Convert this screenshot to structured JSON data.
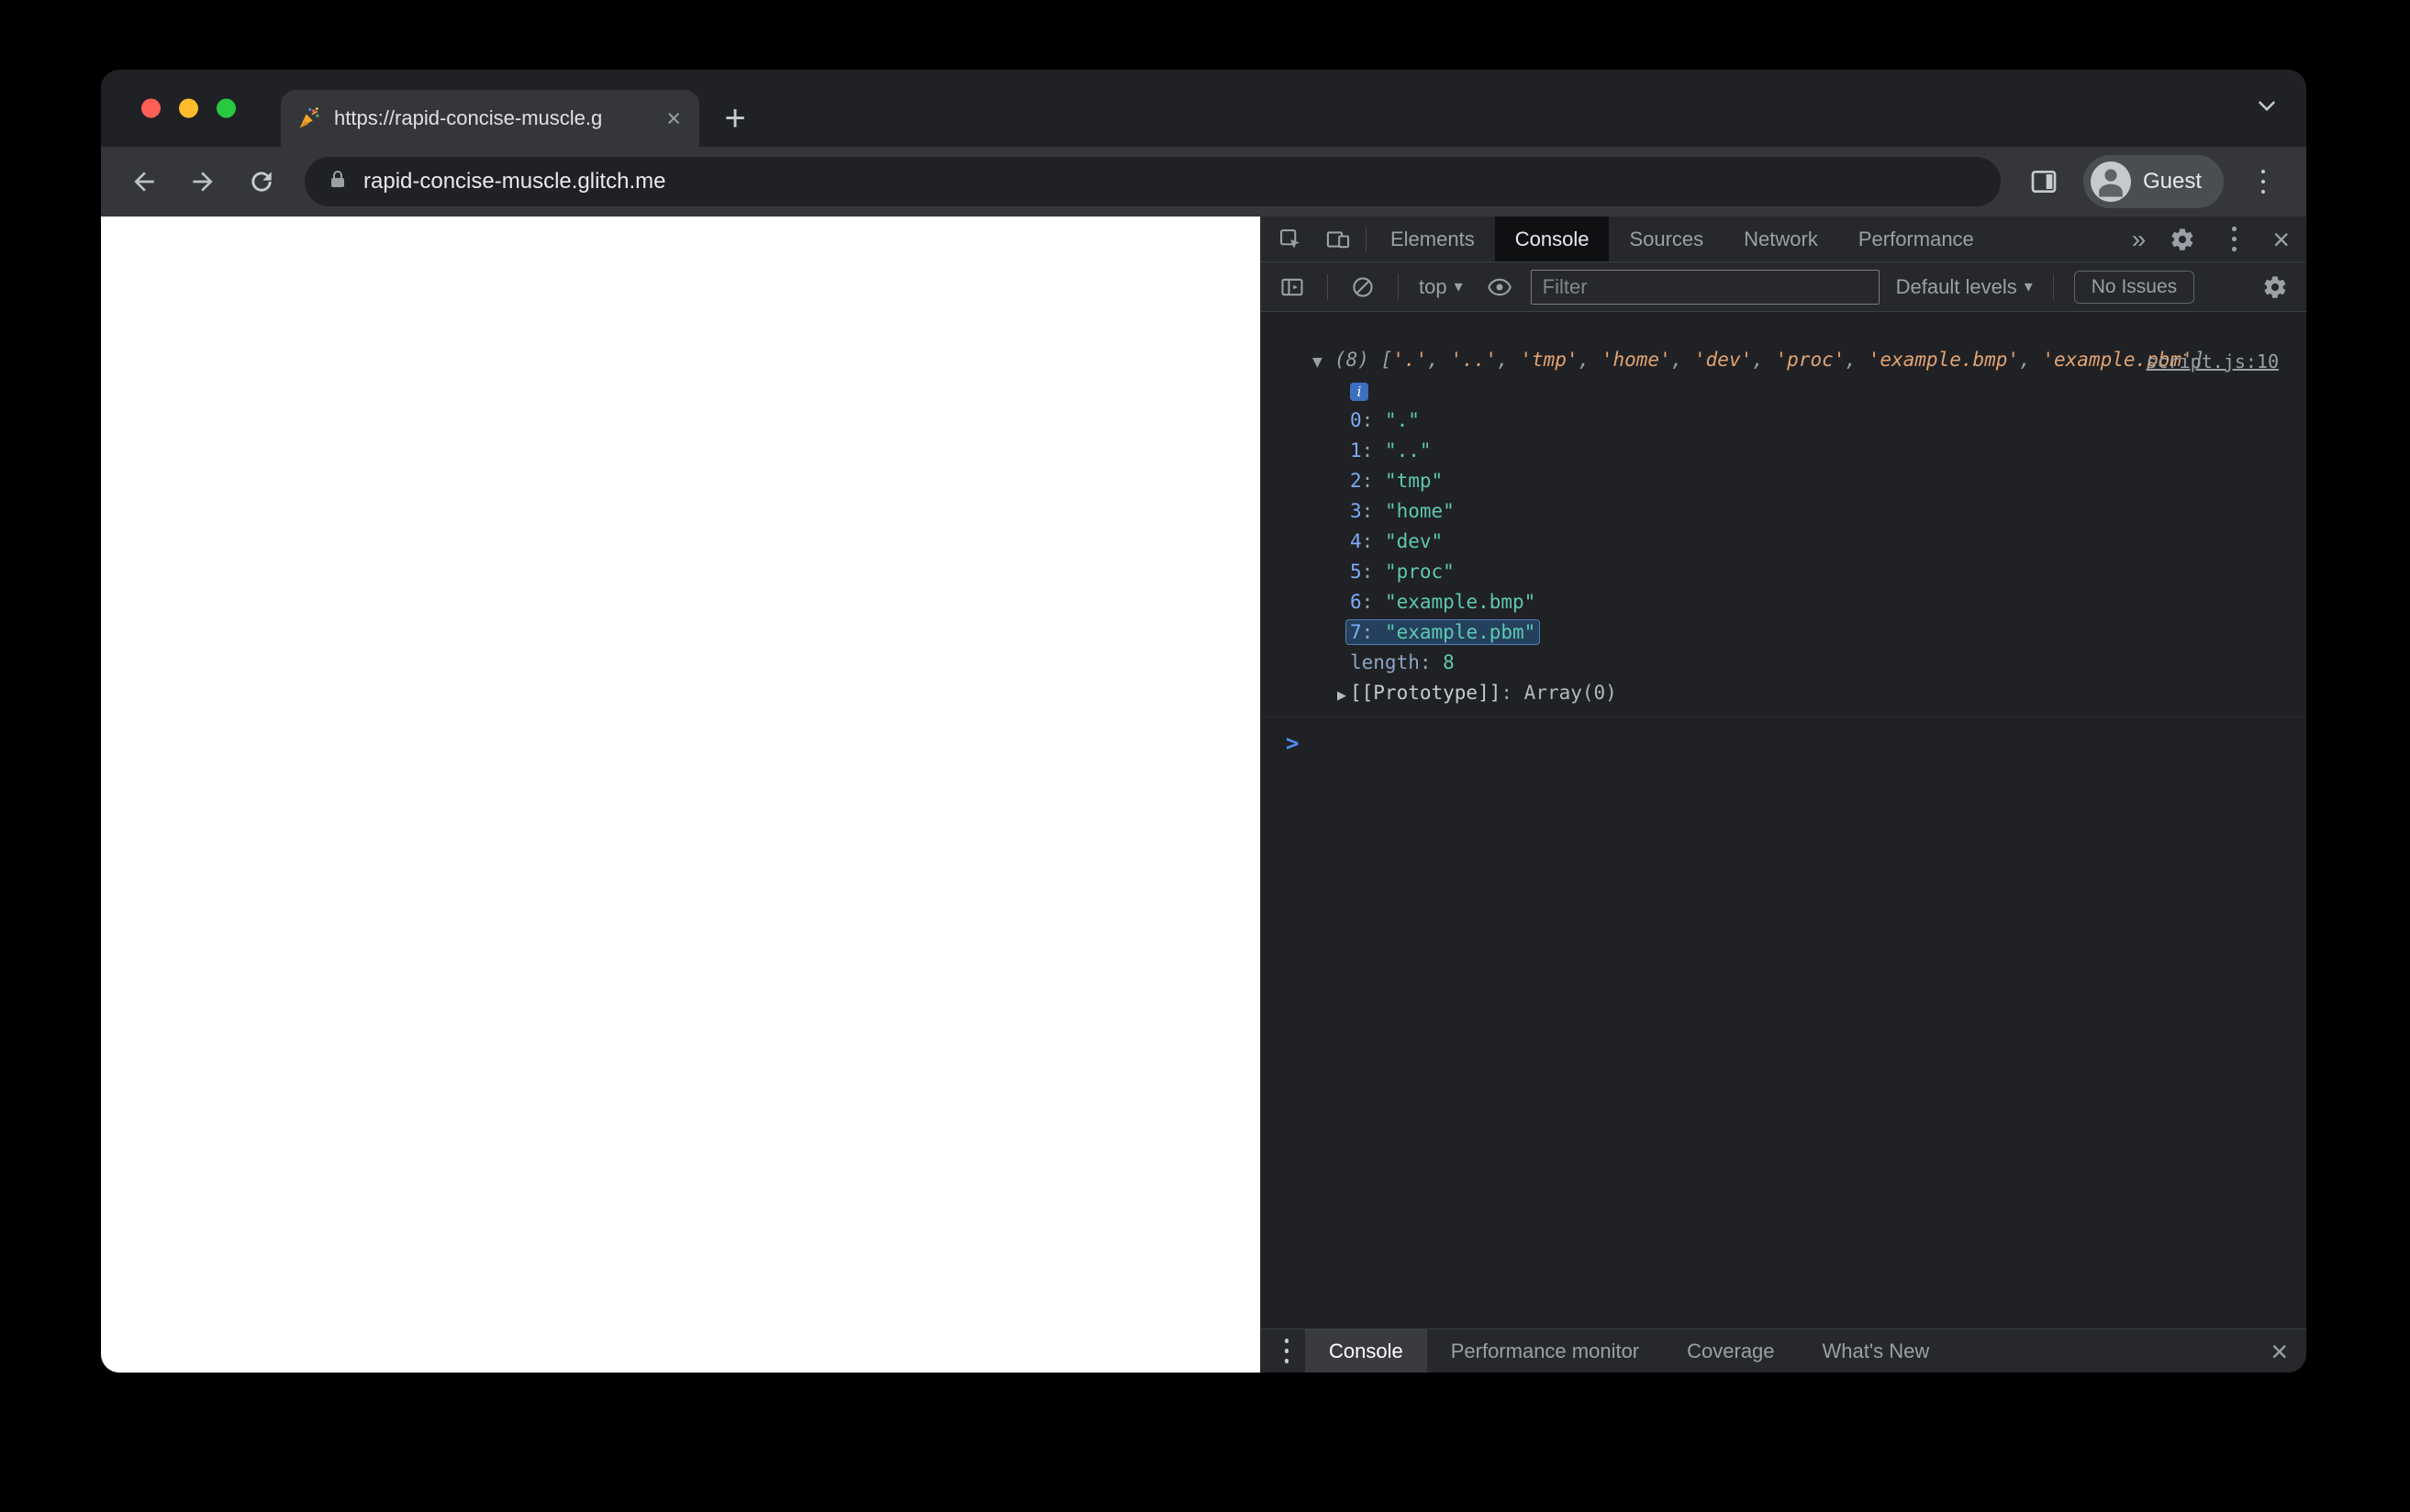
{
  "colors": {
    "traffic_red": "#ff5f57",
    "traffic_yellow": "#febc2e",
    "traffic_green": "#28c840",
    "devtools_bg": "#202124",
    "toolbar_bg": "#35363a",
    "accent_blue": "#7cacf8",
    "string_preview_orange": "#e2a372",
    "string_value_teal": "#5dc9b2"
  },
  "browser": {
    "tab_title": "https://rapid-concise-muscle.g",
    "address": "rapid-concise-muscle.glitch.me",
    "profile_label": "Guest"
  },
  "devtools": {
    "main_tabs": [
      {
        "label": "Elements",
        "selected": false
      },
      {
        "label": "Console",
        "selected": true
      },
      {
        "label": "Sources",
        "selected": false
      },
      {
        "label": "Network",
        "selected": false
      },
      {
        "label": "Performance",
        "selected": false
      }
    ],
    "toolbar": {
      "context_selector": "top",
      "filter_placeholder": "Filter",
      "levels_label": "Default levels",
      "issues_label": "No Issues"
    },
    "console": {
      "source_link": "script.js:10",
      "array_length": "8",
      "values": [
        ".",
        "..",
        "tmp",
        "home",
        "dev",
        "proc",
        "example.bmp",
        "example.pbm"
      ],
      "highlighted_index": 7,
      "length_label": "length",
      "length_value": "8",
      "prototype_label": "[[Prototype]]",
      "prototype_value": "Array(0)"
    },
    "drawer_tabs": [
      {
        "label": "Console",
        "selected": true
      },
      {
        "label": "Performance monitor",
        "selected": false
      },
      {
        "label": "Coverage",
        "selected": false
      },
      {
        "label": "What's New",
        "selected": false
      }
    ]
  },
  "icons": {
    "close": "×",
    "new_tab": "+",
    "more_tabs": "»",
    "dropdown_arrow": "▾",
    "collapse_triangle": "▼",
    "expand_triangle": "▶",
    "prompt_chevron": ">",
    "info": "i"
  }
}
